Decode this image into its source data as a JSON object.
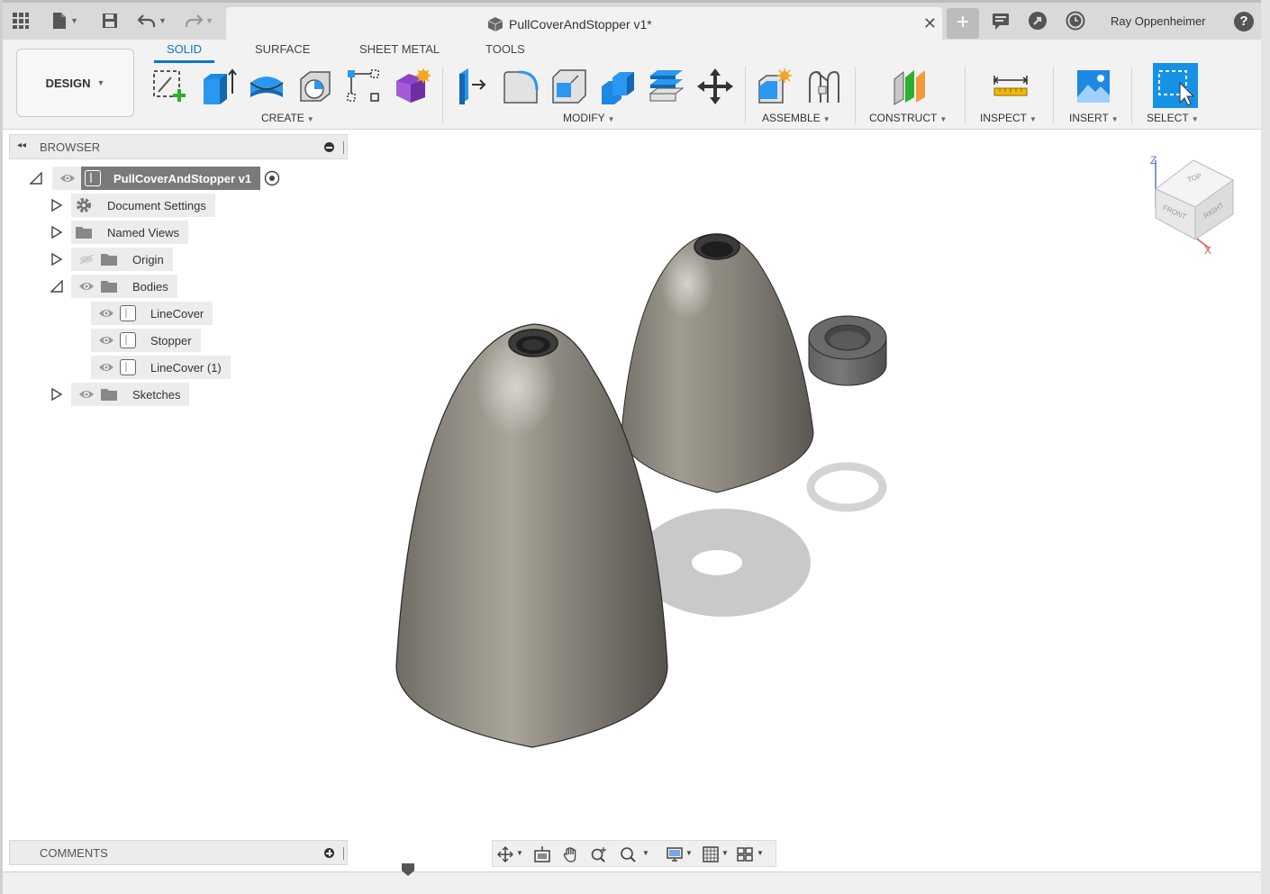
{
  "app": {
    "document_title": "PullCoverAndStopper v1*",
    "user_name": "Ray Oppenheimer",
    "help_symbol": "?",
    "new_tab_symbol": "+",
    "close_symbol": "✕"
  },
  "workspace": {
    "mode_label": "DESIGN",
    "tabs": [
      {
        "label": "SOLID"
      },
      {
        "label": "SURFACE"
      },
      {
        "label": "SHEET METAL"
      },
      {
        "label": "TOOLS"
      }
    ]
  },
  "toolbar": {
    "groups": {
      "create": "CREATE",
      "modify": "MODIFY",
      "assemble": "ASSEMBLE",
      "construct": "CONSTRUCT",
      "inspect": "INSPECT",
      "insert": "INSERT",
      "select": "SELECT"
    },
    "colors": {
      "accent": "#0a77c6",
      "select_active": "#1592e6"
    }
  },
  "browser": {
    "title": "BROWSER",
    "collapse_symbol": "◂◂",
    "root": "PullCoverAndStopper v1",
    "items": [
      {
        "label": "Document Settings"
      },
      {
        "label": "Named Views"
      },
      {
        "label": "Origin"
      },
      {
        "label": "Bodies"
      },
      {
        "label": "LineCover"
      },
      {
        "label": "Stopper"
      },
      {
        "label": "LineCover (1)"
      },
      {
        "label": "Sketches"
      }
    ]
  },
  "comments": {
    "title": "COMMENTS"
  },
  "viewcube": {
    "top": "TOP",
    "front": "FRONT",
    "right": "RIGHT",
    "axis_z": "Z",
    "axis_x": "X"
  }
}
